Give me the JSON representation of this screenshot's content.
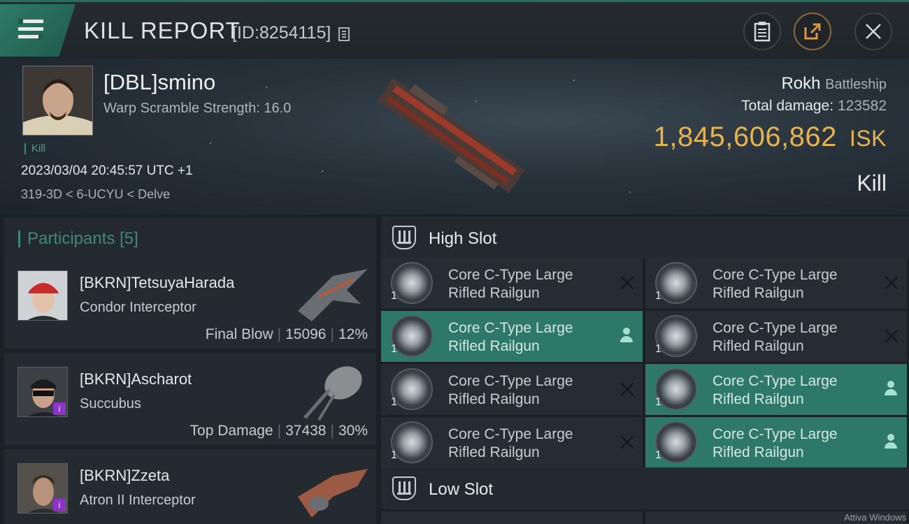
{
  "header": {
    "title": "KILL REPORT",
    "report_id": "[ID:8254115]",
    "icons": [
      "menu-icon",
      "copy-icon",
      "clipboard-icon",
      "share-icon",
      "close-icon"
    ]
  },
  "victim": {
    "name": "[DBL]smino",
    "warp_scramble": "Warp Scramble Strength: 16.0",
    "tag": "Kill",
    "datetime": "2023/03/04 20:45:57 UTC +1",
    "location": "319-3D < 6-UCYU < Delve",
    "ship_name": "Rokh",
    "ship_class": "Battleship",
    "total_damage_label": "Total damage:",
    "total_damage_value": "123582",
    "isk_value": "1,845,606,862",
    "isk_unit": "ISK",
    "result": "Kill"
  },
  "participants": {
    "title": "Participants",
    "count": "[5]",
    "items": [
      {
        "name": "[BKRN]TetsuyaHarada",
        "ship": "Condor Interceptor",
        "label": "Final Blow",
        "damage": "15096",
        "percent": "12%"
      },
      {
        "name": "[BKRN]Ascharot",
        "ship": "Succubus",
        "label": "Top Damage",
        "damage": "37438",
        "percent": "30%",
        "badge": "i"
      },
      {
        "name": "[BKRN]Zzeta",
        "ship": "Atron II Interceptor",
        "badge": "i"
      }
    ]
  },
  "modules": {
    "high_slot_title": "High Slot",
    "low_slot_title": "Low Slot",
    "high_slot": [
      {
        "name": "Core C-Type Large Rifled Railgun",
        "qty": "1",
        "status": "destroyed"
      },
      {
        "name": "Core C-Type Large Rifled Railgun",
        "qty": "1",
        "status": "destroyed"
      },
      {
        "name": "Core C-Type Large Rifled Railgun",
        "qty": "1",
        "status": "dropped"
      },
      {
        "name": "Core C-Type Large Rifled Railgun",
        "qty": "1",
        "status": "destroyed"
      },
      {
        "name": "Core C-Type Large Rifled Railgun",
        "qty": "1",
        "status": "destroyed"
      },
      {
        "name": "Core C-Type Large Rifled Railgun",
        "qty": "1",
        "status": "dropped"
      },
      {
        "name": "Core C-Type Large Rifled Railgun",
        "qty": "1",
        "status": "destroyed"
      },
      {
        "name": "Core C-Type Large Rifled Railgun",
        "qty": "1",
        "status": "dropped"
      }
    ]
  },
  "watermark": "Attiva Windows",
  "colors": {
    "accent": "#2e786a",
    "isk": "#e7b34f",
    "background": "#1b2024",
    "badge": "#8c34c7"
  }
}
